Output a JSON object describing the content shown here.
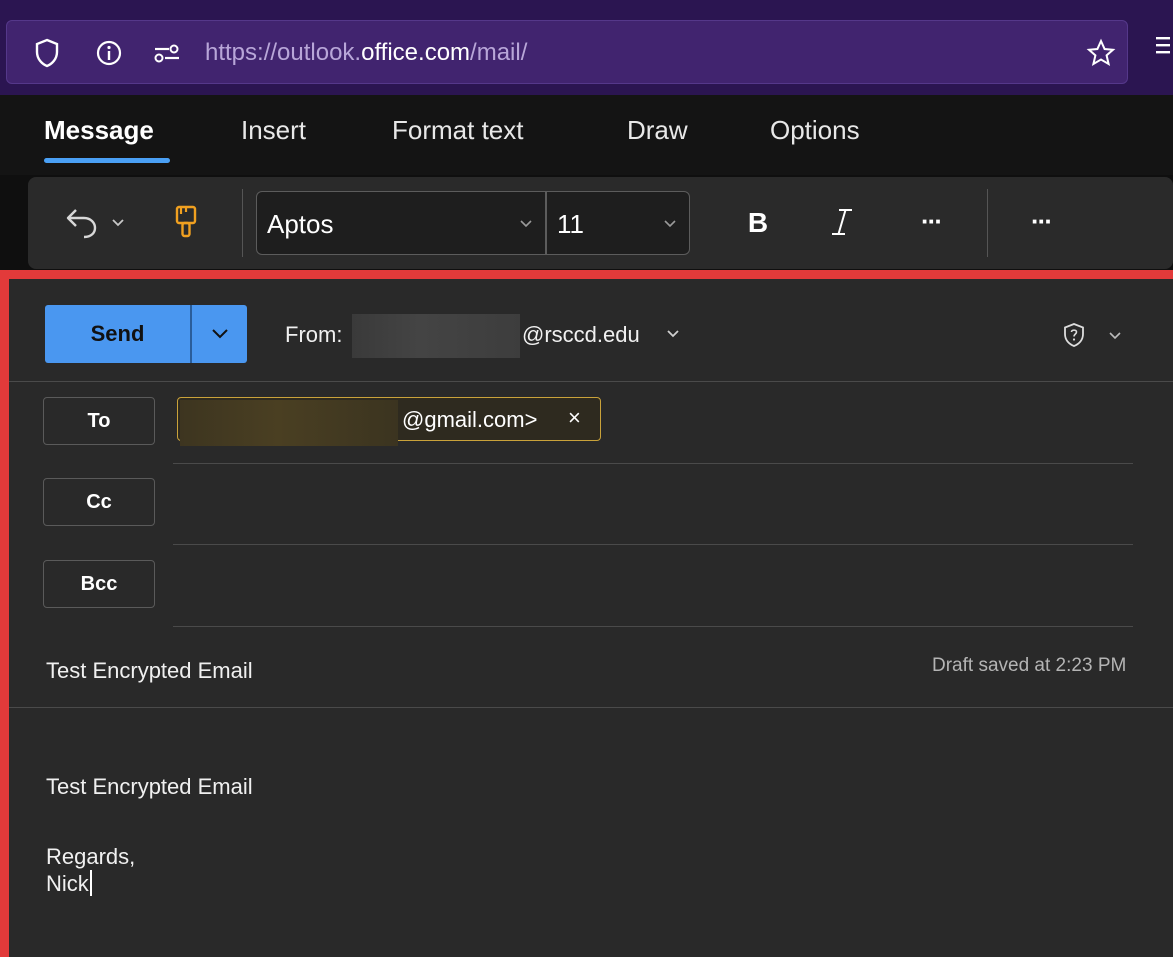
{
  "browser": {
    "url_prefix": "https://outlook.",
    "url_domain": "office.com",
    "url_suffix": "/mail/",
    "icons": [
      "shield-icon",
      "info-icon",
      "permissions-icon",
      "star-icon",
      "menu-icon"
    ]
  },
  "ribbon": {
    "tabs": [
      {
        "label": "Message",
        "active": true
      },
      {
        "label": "Insert",
        "active": false
      },
      {
        "label": "Format text",
        "active": false
      },
      {
        "label": "Draw",
        "active": false
      },
      {
        "label": "Options",
        "active": false
      }
    ],
    "accent": "#4aa0f5"
  },
  "toolbar": {
    "font_name": "Aptos",
    "font_size": "11",
    "bold_label": "B",
    "italic_label": "I",
    "more_label": "···",
    "overflow_label": "···"
  },
  "compose": {
    "send_label": "Send",
    "from_label": "From:",
    "from_domain": "@rsccd.edu",
    "to_label": "To",
    "cc_label": "Cc",
    "bcc_label": "Bcc",
    "recipient_suffix": "@gmail.com>",
    "recipient_remove": "×",
    "subject": "Test Encrypted Email",
    "draft_status": "Draft saved at 2:23 PM",
    "body": {
      "line1": "Test Encrypted Email",
      "line2": "Regards,",
      "line3": "Nick"
    },
    "highlight_color": "#e23a3a",
    "send_color": "#4a97f0"
  }
}
